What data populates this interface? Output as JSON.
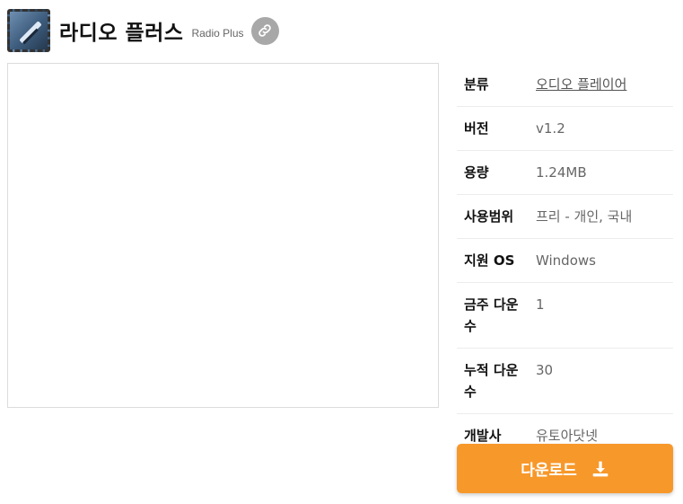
{
  "header": {
    "title": "라디오 플러스",
    "subtitle": "Radio Plus",
    "app_icon": "radio-plus-app-icon",
    "link_icon": "link-icon"
  },
  "info": {
    "rows": [
      {
        "label": "분류",
        "value": "오디오 플레이어"
      },
      {
        "label": "버전",
        "value": "v1.2"
      },
      {
        "label": "용량",
        "value": "1.24MB"
      },
      {
        "label": "사용범위",
        "value": "프리 - 개인, 국내"
      },
      {
        "label": "지원 OS",
        "value": "Windows"
      },
      {
        "label": "금주 다운수",
        "value": "1"
      },
      {
        "label": "누적 다운수",
        "value": "30"
      },
      {
        "label": "개발사",
        "value": "유토아닷넷"
      }
    ]
  },
  "download": {
    "label": "다운로드",
    "icon": "download-icon",
    "color": "#f7982a"
  }
}
